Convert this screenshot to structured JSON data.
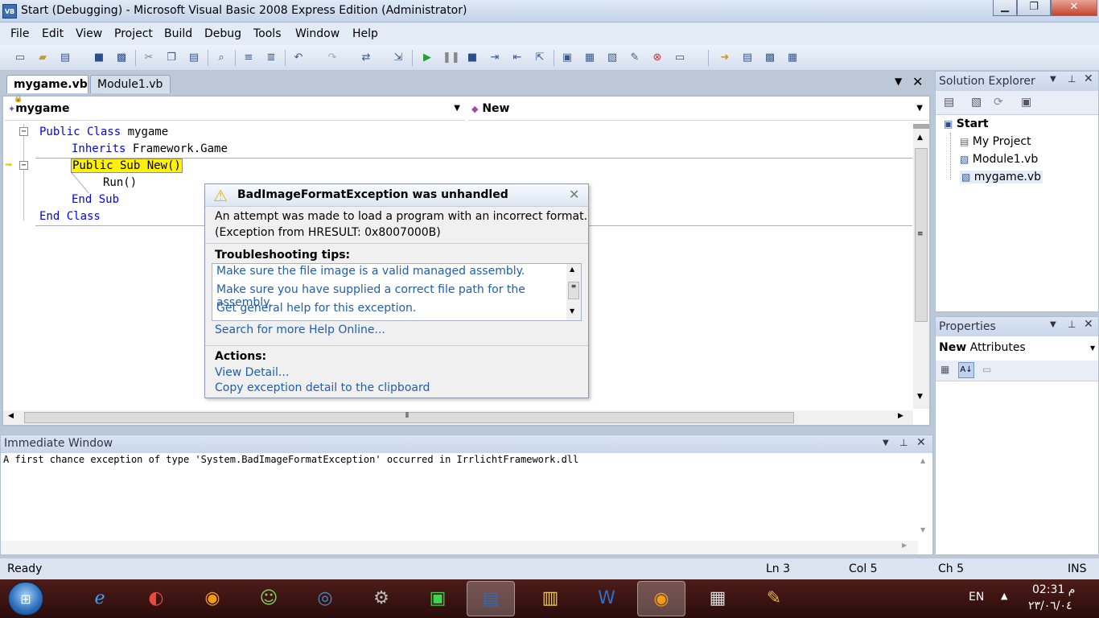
{
  "window": {
    "title": "Start (Debugging) - Microsoft Visual Basic 2008 Express Edition (Administrator)",
    "icon": "VB"
  },
  "menu": [
    "File",
    "Edit",
    "View",
    "Project",
    "Build",
    "Debug",
    "Tools",
    "Window",
    "Help"
  ],
  "tabs": [
    {
      "label": "mygame.vb"
    },
    {
      "label": "Module1.vb"
    }
  ],
  "combos": {
    "left": "mygame",
    "right": "New"
  },
  "code": {
    "l1a": "Public Class",
    "l1b": " mygame",
    "l2a": "Inherits",
    "l2b": " Framework.Game",
    "l3": "Public Sub New()",
    "l4": "Run()",
    "l5": "End Sub",
    "l6": "End Class"
  },
  "exception": {
    "title": "BadImageFormatException was unhandled",
    "message1": "An attempt was made to load a program with an incorrect format.",
    "message2": "(Exception from HRESULT: 0x8007000B)",
    "tips_header": "Troubleshooting tips:",
    "tips": [
      "Make sure the file image is a valid managed assembly.",
      "Make sure you have supplied a correct file path for the assembly.",
      "Get general help for this exception."
    ],
    "search": "Search for more Help Online...",
    "actions_header": "Actions:",
    "actions": [
      "View Detail...",
      "Copy exception detail to the clipboard"
    ]
  },
  "solution_explorer": {
    "title": "Solution Explorer",
    "items": [
      {
        "label": "Start"
      },
      {
        "label": "My Project"
      },
      {
        "label": "Module1.vb"
      },
      {
        "label": "mygame.vb"
      }
    ]
  },
  "properties": {
    "title": "Properties",
    "object": "New",
    "object_type": "Attributes"
  },
  "immediate": {
    "title": "Immediate Window",
    "text": "A first chance exception of type 'System.BadImageFormatException' occurred in IrrlichtFramework.dll"
  },
  "status": {
    "ready": "Ready",
    "ln": "Ln 3",
    "col": "Col 5",
    "ch": "Ch 5",
    "ins": "INS"
  },
  "taskbar": {
    "lang": "EN",
    "time": "02:31 م",
    "date": "٢٣/٠٦/٠٤"
  }
}
